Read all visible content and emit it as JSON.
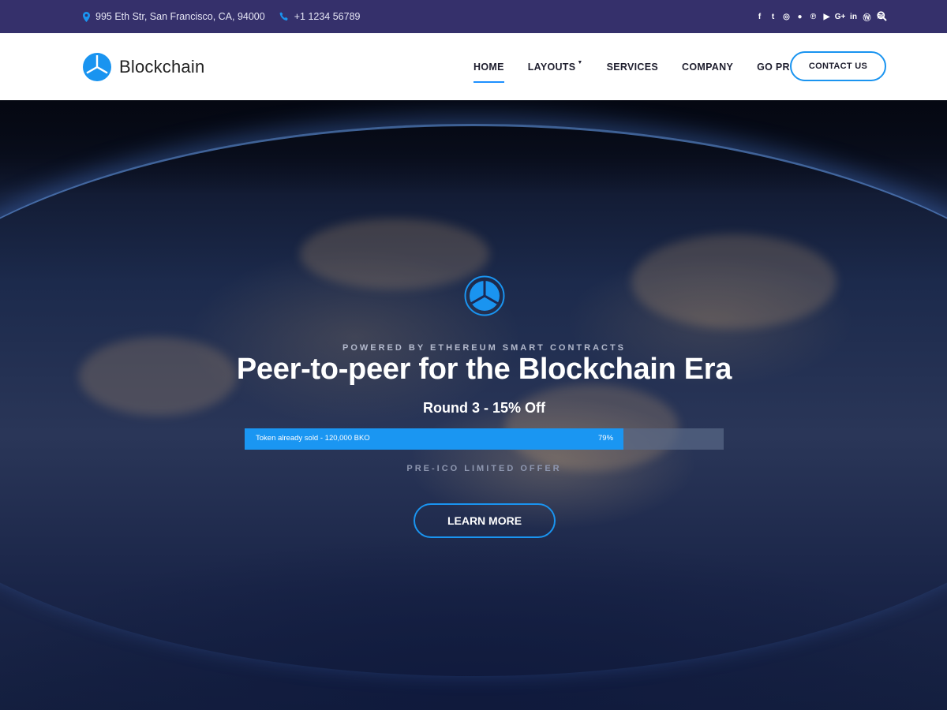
{
  "topbar": {
    "address": "995 Eth Str, San Francisco, CA, 94000",
    "phone": "+1 1234 56789",
    "socials": [
      {
        "name": "facebook-icon",
        "glyph": "f"
      },
      {
        "name": "twitter-icon",
        "glyph": "t"
      },
      {
        "name": "instagram-icon",
        "glyph": "◎"
      },
      {
        "name": "reddit-icon",
        "glyph": "●"
      },
      {
        "name": "pinterest-icon",
        "glyph": "℗"
      },
      {
        "name": "youtube-icon",
        "glyph": "▶"
      },
      {
        "name": "google-plus-icon",
        "glyph": "G+"
      },
      {
        "name": "linkedin-icon",
        "glyph": "in"
      },
      {
        "name": "wordpress-icon",
        "glyph": "Ⓦ"
      },
      {
        "name": "rss-icon",
        "glyph": "≋"
      }
    ]
  },
  "header": {
    "logo_text": "Blockchain",
    "nav": [
      {
        "label": "HOME",
        "active": true,
        "dropdown": false
      },
      {
        "label": "LAYOUTS",
        "active": false,
        "dropdown": true
      },
      {
        "label": "SERVICES",
        "active": false,
        "dropdown": false
      },
      {
        "label": "COMPANY",
        "active": false,
        "dropdown": false
      },
      {
        "label": "GO PRO",
        "active": false,
        "dropdown": false
      }
    ],
    "contact_label": "CONTACT US"
  },
  "hero": {
    "kicker": "POWERED BY ETHEREUM SMART CONTRACTS",
    "headline": "Peer-to-peer for the Blockchain Era",
    "round": "Round 3 - 15% Off",
    "progress": {
      "label": "Token already sold - 120,000 BKO",
      "percent_text": "79%",
      "fraction": 0.79
    },
    "preico": "PRE-ICO LIMITED OFFER",
    "button_label": "LEARN MORE"
  },
  "colors": {
    "topbar_bg": "#35306b",
    "accent": "#1a94f0"
  }
}
